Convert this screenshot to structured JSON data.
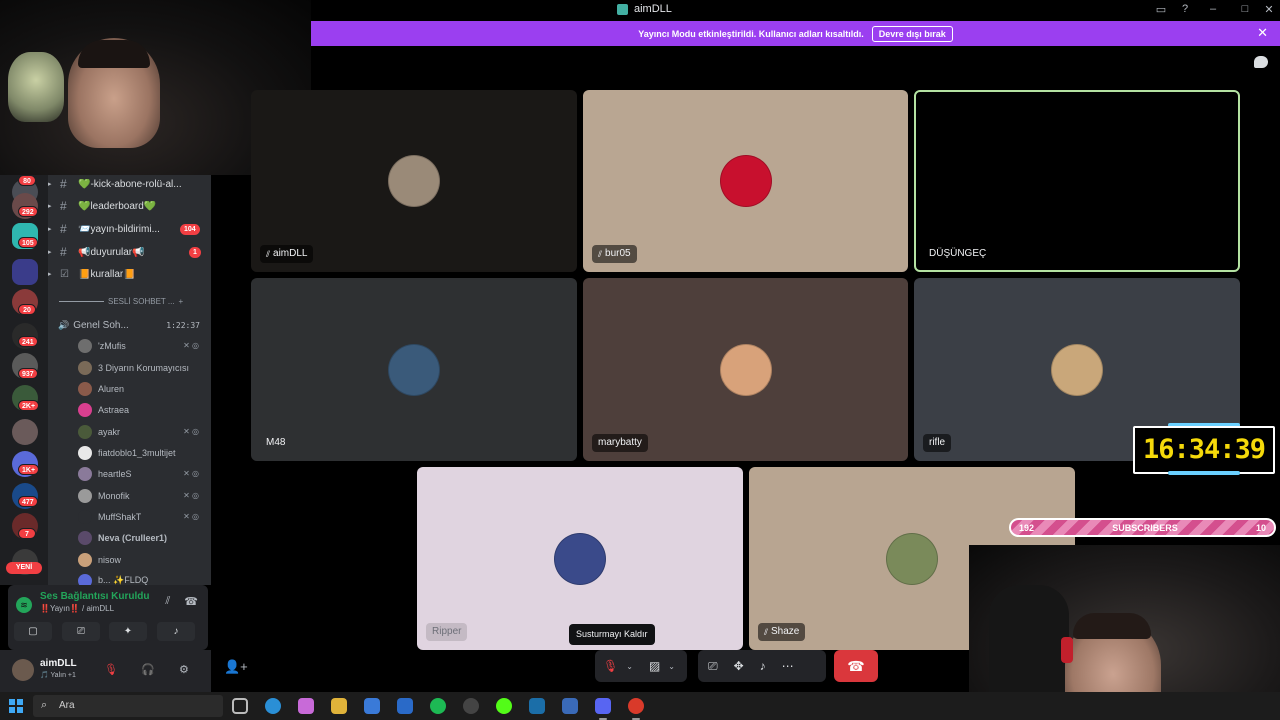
{
  "window": {
    "title": "aimDLL"
  },
  "banner": {
    "text": "Yayıncı Modu etkinleştirildi. Kullanıcı adları kısaltıldı.",
    "button": "Devre dışı bırak"
  },
  "rail": {
    "badges": [
      "80",
      "292",
      "105",
      "20",
      "241",
      "937",
      "2K+",
      "1K+",
      "477",
      "7"
    ],
    "new_label": "YENİ"
  },
  "channels": [
    {
      "name": "💚-kick-abone-rolü-al...",
      "mention": ""
    },
    {
      "name": "💚leaderboard💚",
      "mention": ""
    },
    {
      "name": "📨yayın-bildirimi...",
      "mention": "104"
    },
    {
      "name": "📢duyurular📢",
      "mention": "1"
    },
    {
      "name": "📙kurallar📙",
      "mention": ""
    }
  ],
  "voice": {
    "category": "SESLİ SOHBET ...",
    "channel": "Genel Soh...",
    "timer": "1:22:37",
    "members": [
      {
        "name": "'zMufis",
        "icons": "✕ ◎",
        "color": "#6e6e6e"
      },
      {
        "name": "3 Diyarın Korumayıcısı",
        "icons": "",
        "color": "#7a6a58"
      },
      {
        "name": "Aluren",
        "icons": "",
        "color": "#8a5a4a"
      },
      {
        "name": "Astraea",
        "icons": "",
        "color": "#d93f8f"
      },
      {
        "name": "ayakr",
        "icons": "✕ ◎",
        "color": "#4a5a3a"
      },
      {
        "name": "fiatdoblo1_3multijet",
        "icons": "",
        "color": "#e8e8e8"
      },
      {
        "name": "heartleS",
        "icons": "✕ ◎",
        "color": "#8a7a9a"
      },
      {
        "name": "Monofik",
        "icons": "✕ ◎",
        "color": "#9a9a9a"
      },
      {
        "name": "MuffShakT",
        "icons": "✕ ◎",
        "color": "#2b2d31"
      },
      {
        "name": "Neva (Crulleer1)",
        "icons": "",
        "color": "#5a4a6a"
      },
      {
        "name": "nisow",
        "icons": "",
        "color": "#c9a07a"
      },
      {
        "name": "b... ✨FLDQ",
        "icons": "",
        "color": "#5a6ad9"
      }
    ]
  },
  "voice_panel": {
    "status": "Ses Bağlantısı Kuruldu",
    "sub": "‼️Yayın‼️ / aimDLL"
  },
  "user": {
    "name": "aimDLL",
    "status": "🎵 Yalın +1"
  },
  "tiles": [
    {
      "name": "aimDLL",
      "muted": true,
      "bg": "#1a1816",
      "avatar": "#9a8a78",
      "speaking": false,
      "light": false
    },
    {
      "name": "bur05",
      "muted": true,
      "bg": "#b9a692",
      "avatar": "#c8102e",
      "speaking": false,
      "light": false
    },
    {
      "name": "DÜŞÜNGEÇ",
      "muted": false,
      "bg": "#000000",
      "avatar": "#000000",
      "speaking": true,
      "light": false
    },
    {
      "name": "M48",
      "muted": false,
      "bg": "#2e3032",
      "avatar": "#3a5a7a",
      "speaking": false,
      "light": false
    },
    {
      "name": "marybatty",
      "muted": false,
      "bg": "#4e3f3b",
      "avatar": "#d8a27a",
      "speaking": false,
      "light": false
    },
    {
      "name": "rifle",
      "muted": false,
      "bg": "#3b3f46",
      "avatar": "#c9a77a",
      "speaking": false,
      "light": false
    },
    {
      "name": "Ripper",
      "muted": false,
      "bg": "#e0d4e0",
      "avatar": "#3a4a8a",
      "speaking": false,
      "light": true
    },
    {
      "name": "Shaze",
      "muted": true,
      "bg": "#b8a591",
      "avatar": "#7a8a5a",
      "speaking": false,
      "light": false
    }
  ],
  "controls": {
    "tooltip": "Susturmayı Kaldır"
  },
  "overlay": {
    "clock": "16:34:39",
    "sub_left": "192",
    "sub_label": "SUBSCRIBERS",
    "sub_right": "10"
  },
  "taskbar": {
    "search_placeholder": "Ara"
  }
}
